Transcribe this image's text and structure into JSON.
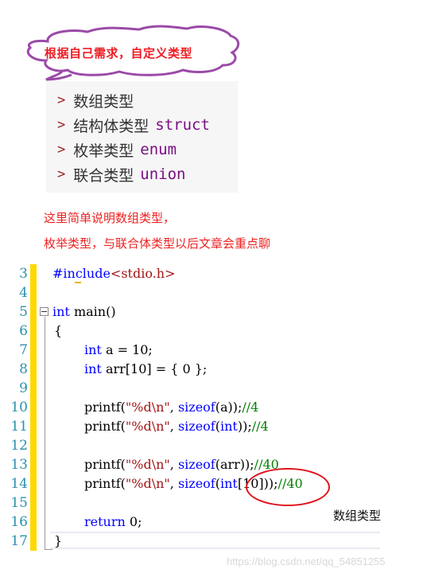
{
  "callout": {
    "title": "根据自己需求，自定义类型",
    "border_color": "#9b4aa8",
    "text_color": "#ee1c24"
  },
  "type_list": {
    "items": [
      {
        "label": "数组类型",
        "keyword": ""
      },
      {
        "label": "结构体类型",
        "keyword": "struct"
      },
      {
        "label": "枚举类型",
        "keyword": "enum"
      },
      {
        "label": "联合类型",
        "keyword": "union"
      }
    ],
    "bullet": ">"
  },
  "notes": {
    "line1": "这里简单说明数组类型，",
    "line2": "枚举类型，与联合体类型以后文章会重点聊"
  },
  "editor": {
    "line_numbers": [
      "3",
      "4",
      "5",
      "6",
      "7",
      "8",
      "9",
      "10",
      "11",
      "12",
      "13",
      "14",
      "15",
      "16",
      "17"
    ],
    "lines": {
      "l3_pp": "#include",
      "l3_hdr": "<stdio.h>",
      "l5_kw": "int",
      "l5_rest": " main()",
      "l6": "{",
      "l7_kw": "int",
      "l7_rest": " a = 10;",
      "l8_kw": "int",
      "l8_rest": " arr[10] = { 0 };",
      "l10_a": "printf(",
      "l10_str": "\"%d\\n\"",
      "l10_b": ", ",
      "l10_kw": "sizeof",
      "l10_c": "(a));",
      "l10_cmt": "//4",
      "l11_a": "printf(",
      "l11_str": "\"%d\\n\"",
      "l11_b": ", ",
      "l11_kw": "sizeof",
      "l11_c": "(",
      "l11_kw2": "int",
      "l11_d": "));",
      "l11_cmt": "//4",
      "l13_a": "printf(",
      "l13_str": "\"%d\\n\"",
      "l13_b": ", ",
      "l13_kw": "sizeof",
      "l13_c": "(arr));",
      "l13_cmt": "//40",
      "l14_a": "printf(",
      "l14_str": "\"%d\\n\"",
      "l14_b": ", ",
      "l14_kw": "sizeof",
      "l14_c": "(",
      "l14_kw2": "int",
      "l14_d": "[10]));",
      "l14_cmt": "//40",
      "l16_kw": "return",
      "l16_rest": " 0;",
      "l17": "}"
    }
  },
  "annotation": {
    "label": "数组类型",
    "ellipse_color": "#e0101a"
  },
  "watermark": "https://blog.csdn.net/qq_54851255"
}
